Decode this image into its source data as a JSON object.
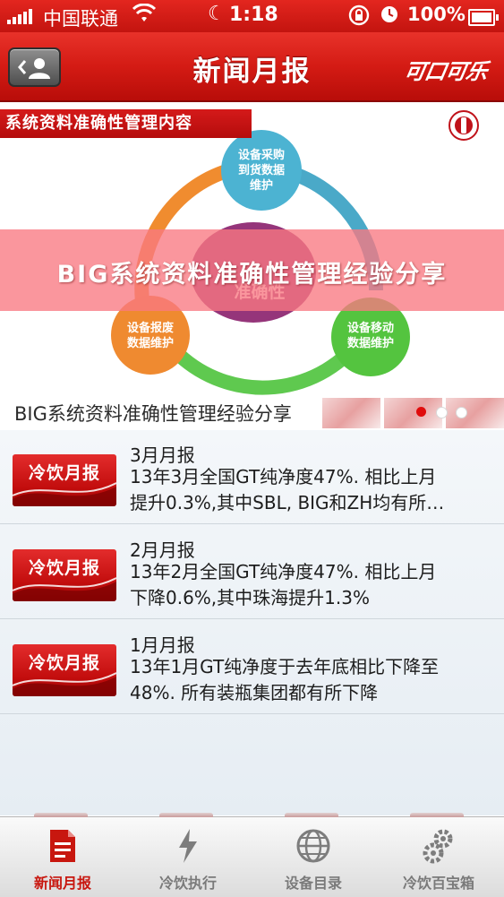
{
  "status_bar": {
    "carrier": "中国联通",
    "time": "1:18",
    "battery": "100%"
  },
  "nav": {
    "title": "新闻月报",
    "brand": "可口可乐"
  },
  "banner": {
    "header": "系统资料准确性管理内容",
    "center_label": "准确性",
    "nodes": [
      "设备采购\n到货数据\n维护",
      "设备报废\n数据维护",
      "设备移动\n数据维护"
    ],
    "overlay_title": "BIG系统资料准确性管理经验分享",
    "caption": "BIG系统资料准确性管理经验分享",
    "pages": 3,
    "active_page": 1
  },
  "list": {
    "thumb_label": "冷饮月报",
    "items": [
      {
        "title": "3月月报",
        "line1": "13年3月全国GT纯净度47%. 相比上月",
        "line2": "提升0.3%,其中SBL, BIG和ZH均有所…"
      },
      {
        "title": "2月月报",
        "line1": "13年2月全国GT纯净度47%. 相比上月",
        "line2": "下降0.6%,其中珠海提升1.3%"
      },
      {
        "title": "1月月报",
        "line1": "13年1月GT纯净度于去年底相比下降至",
        "line2": "48%. 所有装瓶集团都有所下降"
      }
    ]
  },
  "tabs": [
    {
      "label": "新闻月报",
      "icon": "document-icon",
      "active": true
    },
    {
      "label": "冷饮执行",
      "icon": "bolt-icon",
      "active": false
    },
    {
      "label": "设备目录",
      "icon": "globe-icon",
      "active": false
    },
    {
      "label": "冷饮百宝箱",
      "icon": "gears-icon",
      "active": false
    }
  ],
  "colors": {
    "brand_red": "#d41b14",
    "active_tab": "#c8170f"
  }
}
